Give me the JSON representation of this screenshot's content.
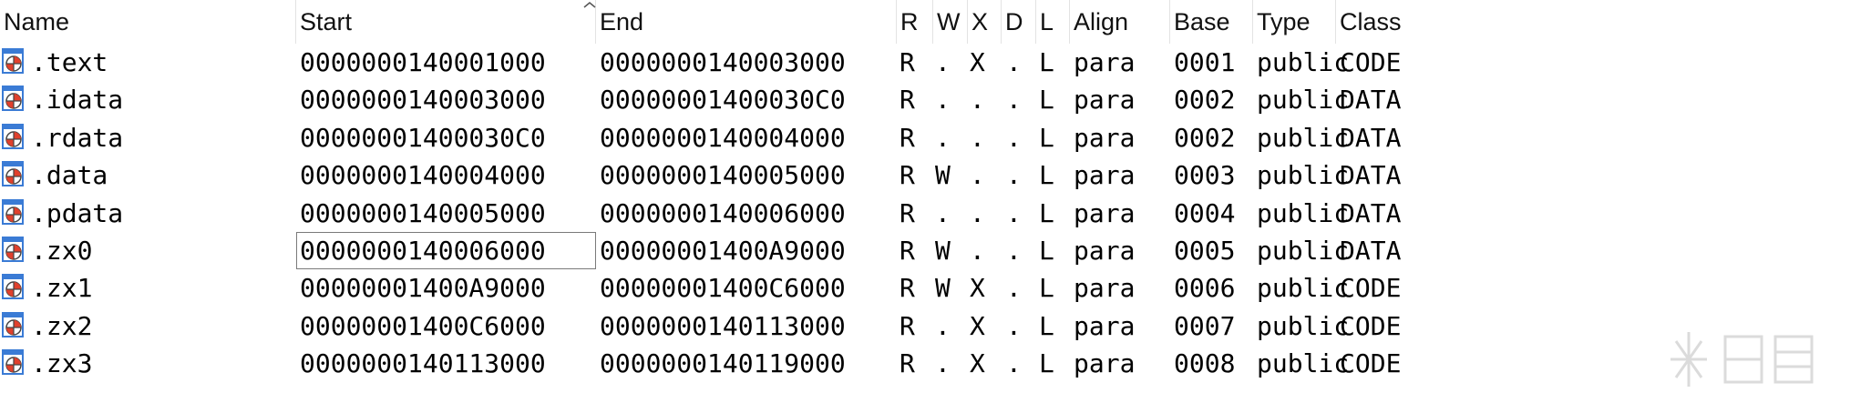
{
  "columns": [
    {
      "key": "name",
      "label": "Name"
    },
    {
      "key": "start",
      "label": "Start"
    },
    {
      "key": "end",
      "label": "End"
    },
    {
      "key": "r",
      "label": "R"
    },
    {
      "key": "w",
      "label": "W"
    },
    {
      "key": "x",
      "label": "X"
    },
    {
      "key": "d",
      "label": "D"
    },
    {
      "key": "l",
      "label": "L"
    },
    {
      "key": "align",
      "label": "Align"
    },
    {
      "key": "base",
      "label": "Base"
    },
    {
      "key": "type",
      "label": "Type"
    },
    {
      "key": "class",
      "label": "Class"
    }
  ],
  "sort": {
    "column": "start",
    "direction": "ascending"
  },
  "segments": [
    {
      "name": ".text",
      "start": "0000000140001000",
      "end": "0000000140003000",
      "r": "R",
      "w": ".",
      "x": "X",
      "d": ".",
      "l": "L",
      "align": "para",
      "base": "0001",
      "type": "public",
      "class": "CODE"
    },
    {
      "name": ".idata",
      "start": "0000000140003000",
      "end": "00000001400030C0",
      "r": "R",
      "w": ".",
      "x": ".",
      "d": ".",
      "l": "L",
      "align": "para",
      "base": "0002",
      "type": "public",
      "class": "DATA"
    },
    {
      "name": ".rdata",
      "start": "00000001400030C0",
      "end": "0000000140004000",
      "r": "R",
      "w": ".",
      "x": ".",
      "d": ".",
      "l": "L",
      "align": "para",
      "base": "0002",
      "type": "public",
      "class": "DATA"
    },
    {
      "name": ".data",
      "start": "0000000140004000",
      "end": "0000000140005000",
      "r": "R",
      "w": "W",
      "x": ".",
      "d": ".",
      "l": "L",
      "align": "para",
      "base": "0003",
      "type": "public",
      "class": "DATA"
    },
    {
      "name": ".pdata",
      "start": "0000000140005000",
      "end": "0000000140006000",
      "r": "R",
      "w": ".",
      "x": ".",
      "d": ".",
      "l": "L",
      "align": "para",
      "base": "0004",
      "type": "public",
      "class": "DATA"
    },
    {
      "name": ".zx0",
      "start": "0000000140006000",
      "end": "00000001400A9000",
      "r": "R",
      "w": "W",
      "x": ".",
      "d": ".",
      "l": "L",
      "align": "para",
      "base": "0005",
      "type": "public",
      "class": "DATA",
      "focused_column": "start"
    },
    {
      "name": ".zx1",
      "start": "00000001400A9000",
      "end": "00000001400C6000",
      "r": "R",
      "w": "W",
      "x": "X",
      "d": ".",
      "l": "L",
      "align": "para",
      "base": "0006",
      "type": "public",
      "class": "CODE"
    },
    {
      "name": ".zx2",
      "start": "00000001400C6000",
      "end": "0000000140113000",
      "r": "R",
      "w": ".",
      "x": "X",
      "d": ".",
      "l": "L",
      "align": "para",
      "base": "0007",
      "type": "public",
      "class": "CODE"
    },
    {
      "name": ".zx3",
      "start": "0000000140113000",
      "end": "0000000140119000",
      "r": "R",
      "w": ".",
      "x": "X",
      "d": ".",
      "l": "L",
      "align": "para",
      "base": "0008",
      "type": "public",
      "class": "CODE"
    }
  ],
  "icons": {
    "segment": "segment-icon",
    "sort": "sort-ascending-caret-icon",
    "watermark": "snowflake-watermark-icon"
  },
  "colors": {
    "icon_blue": "#3a7bd5",
    "icon_red": "#e0402c",
    "focus_border": "#7a7a7a",
    "header_separator": "#e3e3e3"
  }
}
